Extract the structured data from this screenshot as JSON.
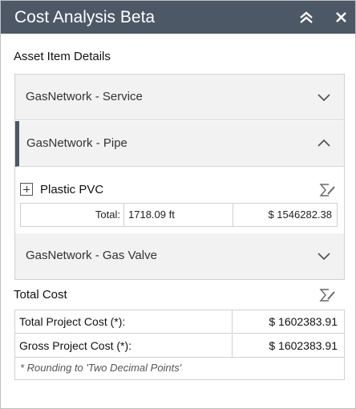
{
  "window": {
    "title": "Cost Analysis Beta"
  },
  "icons": {
    "collapse": "double-chevron-up-icon",
    "close": "close-icon",
    "sigma": "sigma-pencil-icon"
  },
  "asset_details": {
    "heading": "Asset Item Details",
    "groups": [
      {
        "label": "GasNetwork - Service",
        "expanded": false
      },
      {
        "label": "GasNetwork - Pipe",
        "expanded": true
      },
      {
        "label": "GasNetwork - Gas Valve",
        "expanded": false
      }
    ],
    "pipe_item": {
      "name": "Plastic PVC",
      "total_label": "Total:",
      "quantity": "1718.09 ft",
      "cost": "$ 1546282.38"
    }
  },
  "total_cost": {
    "heading": "Total Cost",
    "rows": [
      {
        "label": "Total Project Cost (*):",
        "value": "$ 1602383.91"
      },
      {
        "label": "Gross Project Cost (*):",
        "value": "$ 1602383.91"
      }
    ],
    "note": "* Rounding to 'Two Decimal Points'"
  },
  "colors": {
    "titlebar": "#4d5867",
    "accent": "#4d5867"
  }
}
